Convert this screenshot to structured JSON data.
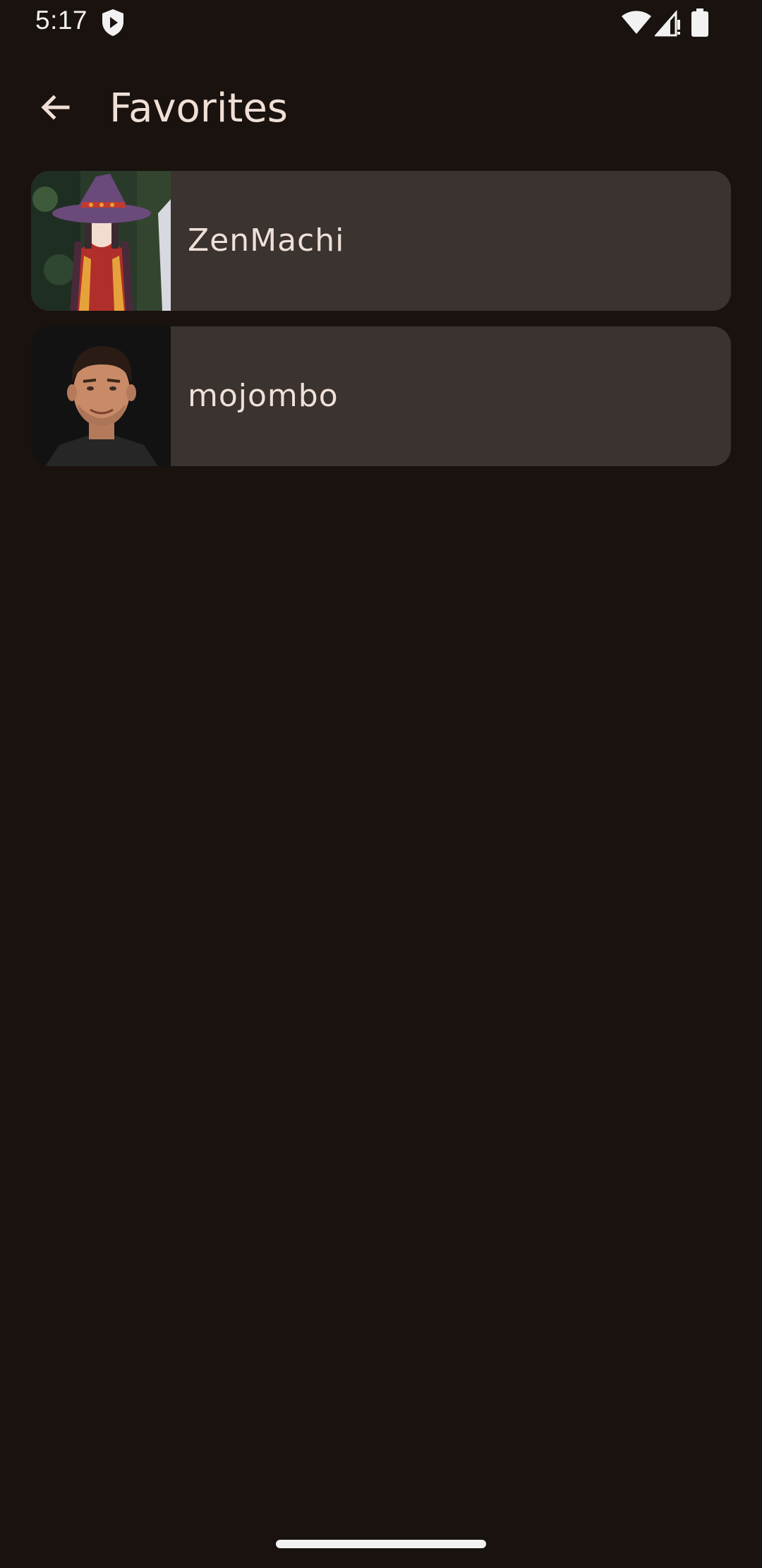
{
  "status_bar": {
    "time": "5:17",
    "icons": [
      "shield-play-icon",
      "wifi-icon",
      "signal-icon",
      "battery-icon"
    ]
  },
  "app_bar": {
    "back_icon": "arrow-back-icon",
    "title": "Favorites"
  },
  "favorites": [
    {
      "name": "ZenMachi",
      "avatar": "anime-witch-avatar"
    },
    {
      "name": "mojombo",
      "avatar": "man-portrait-avatar"
    }
  ],
  "colors": {
    "background": "#1a120e",
    "card": "#3a3330",
    "text": "#efe0d8"
  }
}
